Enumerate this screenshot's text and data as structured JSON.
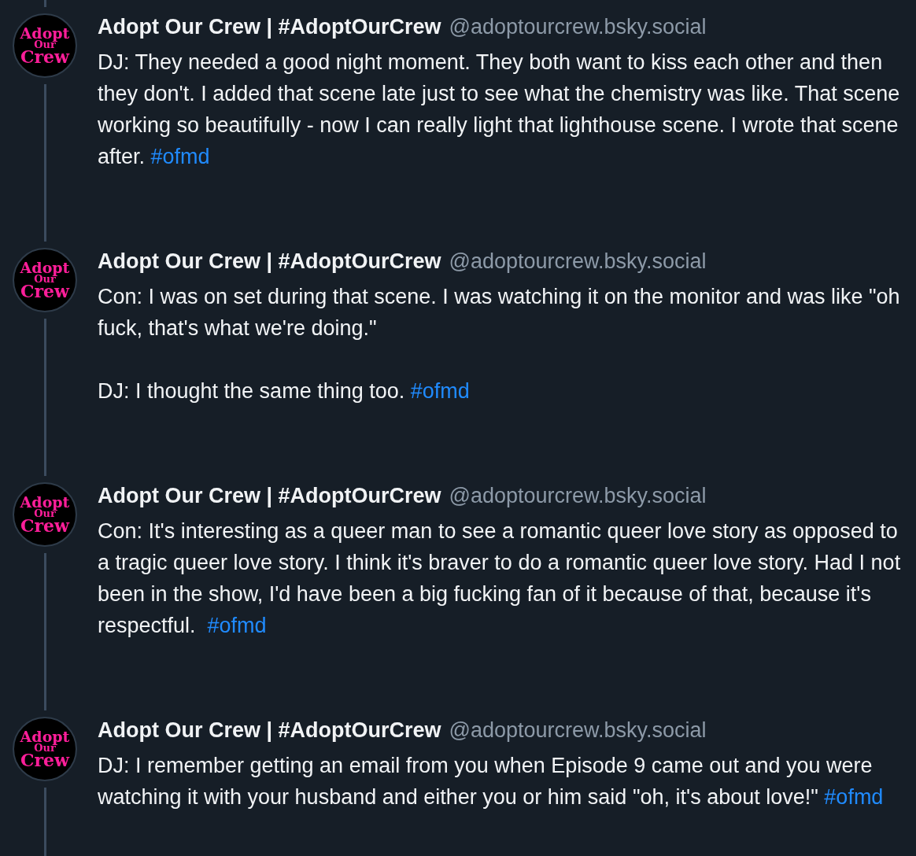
{
  "posts": [
    {
      "avatar_lines": [
        "Adopt",
        "Our",
        "Crew"
      ],
      "display_name": "Adopt Our Crew | #AdoptOurCrew",
      "handle": "@adoptourcrew.bsky.social",
      "text": "DJ: They needed a good night moment. They both want to kiss each other and then they don't. I added that scene late just to see what the chemistry was like. That scene working so beautifully - now I can really light that lighthouse scene. I wrote that scene after.",
      "hashtag": "#ofmd"
    },
    {
      "avatar_lines": [
        "Adopt",
        "Our",
        "Crew"
      ],
      "display_name": "Adopt Our Crew | #AdoptOurCrew",
      "handle": "@adoptourcrew.bsky.social",
      "text": "Con: I was on set during that scene. I was watching it on the monitor and was like \"oh fuck, that's what we're doing.\"\n\nDJ: I thought the same thing too.",
      "hashtag": "#ofmd"
    },
    {
      "avatar_lines": [
        "Adopt",
        "Our",
        "Crew"
      ],
      "display_name": "Adopt Our Crew | #AdoptOurCrew",
      "handle": "@adoptourcrew.bsky.social",
      "text": "Con: It's interesting as a queer man to see a romantic queer love story as opposed to a tragic queer love story. I think it's braver to do a romantic queer love story. Had I not been in the show, I'd have been a big fucking fan of it because of that, because it's respectful. ",
      "hashtag": "#ofmd"
    },
    {
      "avatar_lines": [
        "Adopt",
        "Our",
        "Crew"
      ],
      "display_name": "Adopt Our Crew | #AdoptOurCrew",
      "handle": "@adoptourcrew.bsky.social",
      "text": "DJ: I remember getting an email from you when Episode 9 came out and you were watching it with your husband and either you or him said \"oh, it's about love!\"",
      "hashtag": "#ofmd"
    }
  ]
}
